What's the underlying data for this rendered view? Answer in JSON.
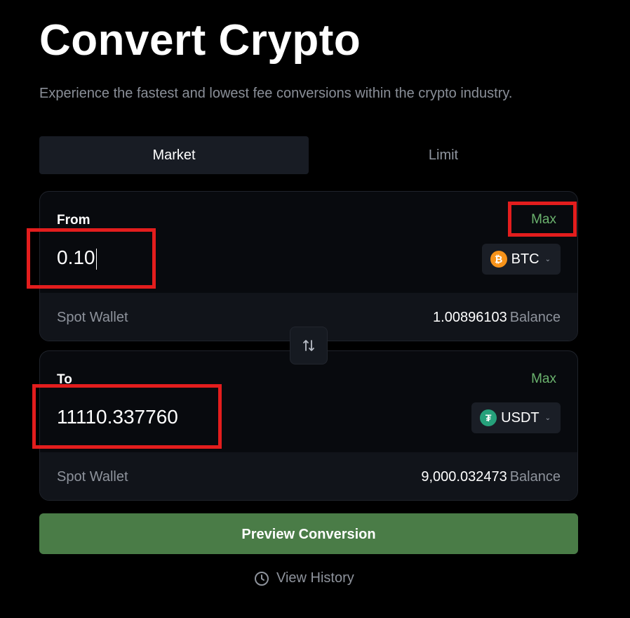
{
  "page": {
    "title": "Convert Crypto",
    "subtitle": "Experience the fastest and lowest fee conversions within the crypto industry."
  },
  "tabs": [
    {
      "label": "Market",
      "active": true
    },
    {
      "label": "Limit",
      "active": false
    }
  ],
  "from": {
    "label": "From",
    "max_label": "Max",
    "amount": "0.10",
    "token": {
      "symbol": "BTC",
      "icon": "bitcoin-icon",
      "color": "#f7931a"
    },
    "wallet": "Spot Wallet",
    "balance": "1.00896103",
    "balance_word": "Balance"
  },
  "to": {
    "label": "To",
    "max_label": "Max",
    "amount": "11110.337760",
    "token": {
      "symbol": "USDT",
      "icon": "tether-icon",
      "color": "#26a17b"
    },
    "wallet": "Spot Wallet",
    "balance": "9,000.032473",
    "balance_word": "Balance"
  },
  "actions": {
    "preview_label": "Preview Conversion",
    "history_label": "View History"
  },
  "colors": {
    "accent_green": "#6bb36e",
    "button_green": "#4a7c47",
    "highlight_red": "#e31d1d"
  }
}
